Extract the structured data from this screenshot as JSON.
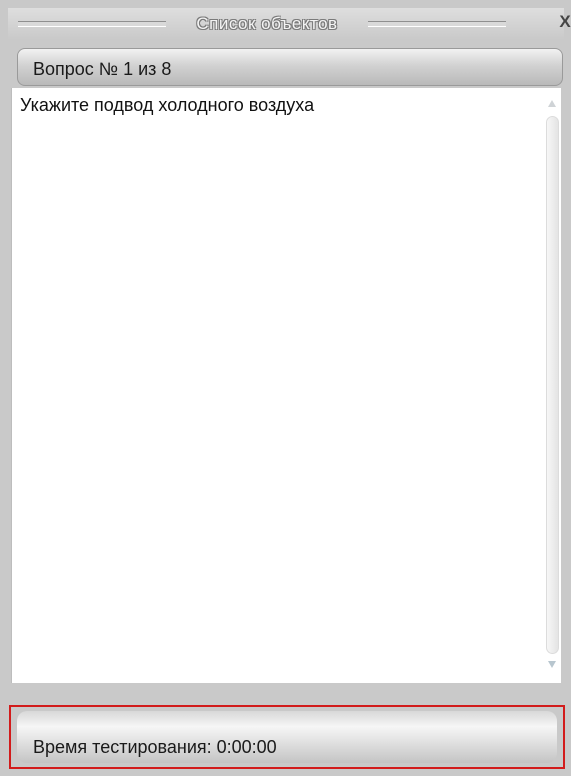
{
  "window": {
    "title": "Список объектов",
    "close_label": "X"
  },
  "question": {
    "header": "Вопрос №  1 из 8",
    "text": "Укажите подвод холодного воздуха"
  },
  "footer": {
    "timer_label": "Время тестирования: 0:00:00"
  },
  "colors": {
    "panel": "#c9c9c9",
    "content_bg": "#ffffff",
    "highlight_border": "#d21b1b"
  }
}
